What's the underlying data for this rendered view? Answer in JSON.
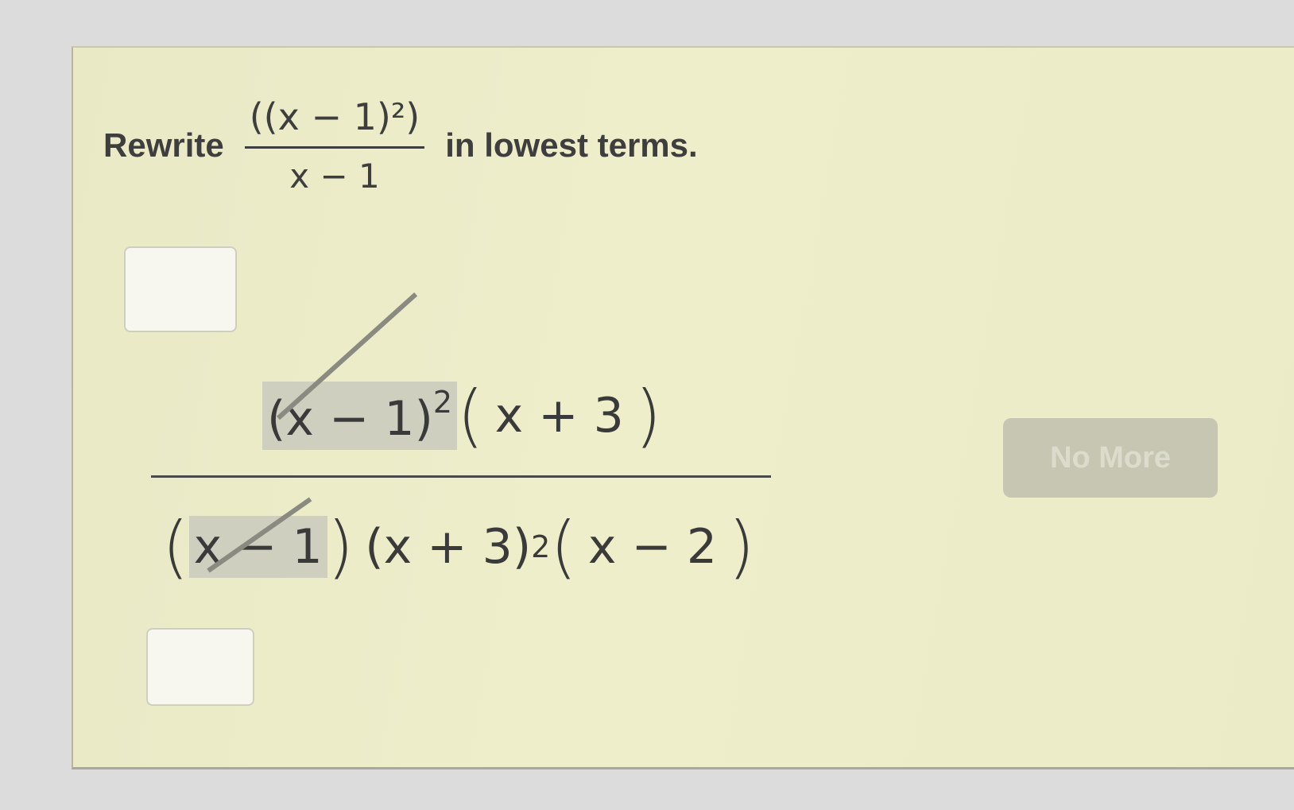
{
  "question": {
    "prefix": "Rewrite",
    "fraction": {
      "numerator": "((x − 1)²)",
      "denominator": "x − 1"
    },
    "suffix": "in lowest terms."
  },
  "work": {
    "numerator": {
      "cancelled_factor": "(x − 1)",
      "cancelled_exp": "2",
      "open_paren": "(",
      "factor2": "x + 3",
      "close_paren": ")"
    },
    "denominator": {
      "open_paren1": "(",
      "cancelled_factor": "x − 1",
      "close_paren1": ")",
      "factor2": "(x + 3)",
      "factor2_exp": "2",
      "open_paren3": "(",
      "factor3": "x − 2",
      "close_paren3": ")"
    }
  },
  "buttons": {
    "no_more": "No More"
  }
}
